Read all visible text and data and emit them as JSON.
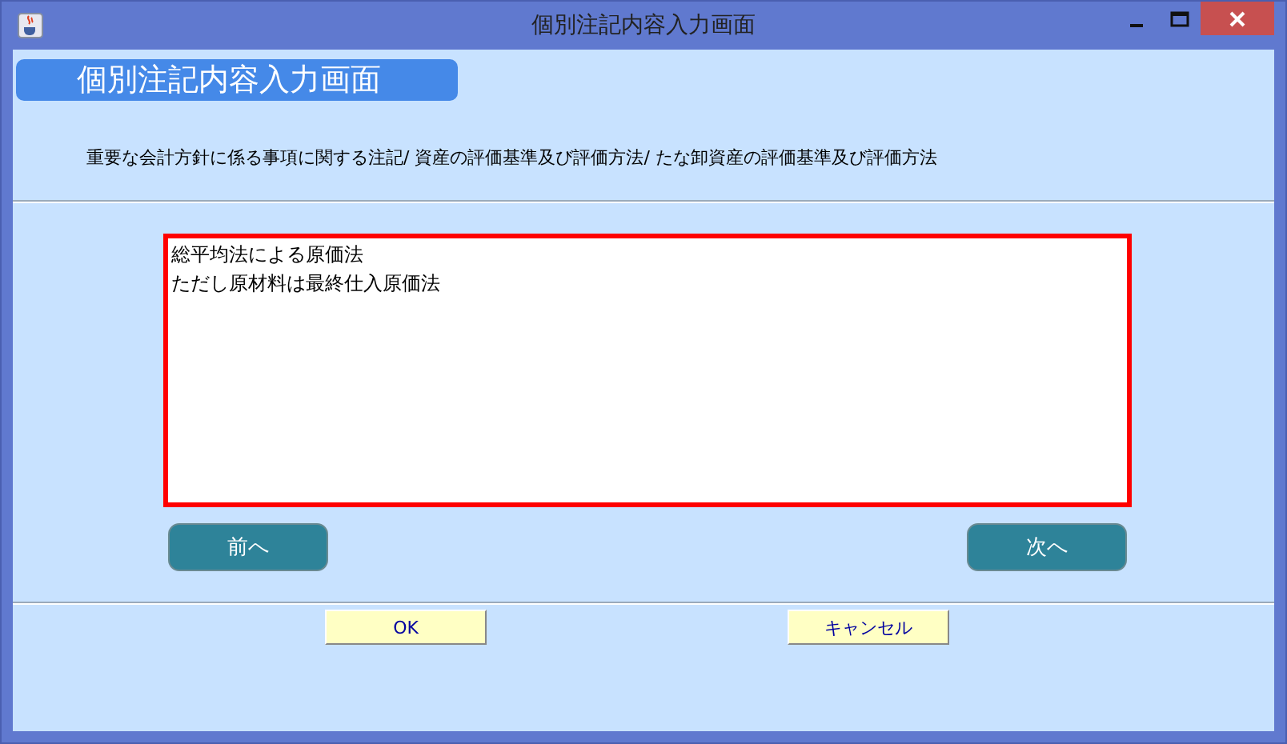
{
  "window": {
    "title": "個別注記内容入力画面"
  },
  "header": {
    "title": "個別注記内容入力画面"
  },
  "description": "重要な会計方針に係る事項に関する注記/ 資産の評価基準及び評価方法/ たな卸資産の評価基準及び評価方法",
  "note_field": {
    "lines": [
      "総平均法による原価法",
      "ただし原材料は最終仕入原価法"
    ]
  },
  "nav_buttons": [
    {
      "label": "前へ"
    },
    {
      "label": "次へ"
    }
  ],
  "dialog_buttons": [
    {
      "label": "OK"
    },
    {
      "label": "キャンセル"
    }
  ]
}
